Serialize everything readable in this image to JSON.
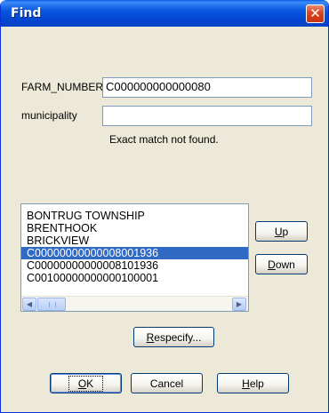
{
  "window": {
    "title": "Find",
    "close_glyph": "✕"
  },
  "fields": [
    {
      "label": "FARM_NUMBER",
      "value": "C000000000000080"
    },
    {
      "label": "municipality",
      "value": ""
    }
  ],
  "status_text": "Exact match not found.",
  "results": {
    "items": [
      {
        "text": "BONTRUG TOWNSHIP",
        "selected": false
      },
      {
        "text": "BRENTHOOK",
        "selected": false
      },
      {
        "text": "BRICKVIEW",
        "selected": false
      },
      {
        "text": "C00000000000008001936",
        "selected": true
      },
      {
        "text": "C00000000000008101936",
        "selected": false
      },
      {
        "text": "C00100000000000100001",
        "selected": false
      }
    ]
  },
  "buttons": {
    "up": {
      "underline": "U",
      "rest": "p"
    },
    "down": {
      "underline": "D",
      "rest": "own"
    },
    "respecify": {
      "underline": "R",
      "rest": "especify..."
    },
    "ok": {
      "underline": "O",
      "rest": "K"
    },
    "cancel": {
      "label": "Cancel"
    },
    "help": {
      "underline": "H",
      "rest": "elp"
    }
  },
  "icons": {
    "scroll_left": "◀",
    "scroll_right": "▶"
  },
  "colors": {
    "title_bar": "#0a56e0",
    "close_button": "#d9441e",
    "selection": "#316ac5",
    "dialog_face": "#ece9d8"
  }
}
